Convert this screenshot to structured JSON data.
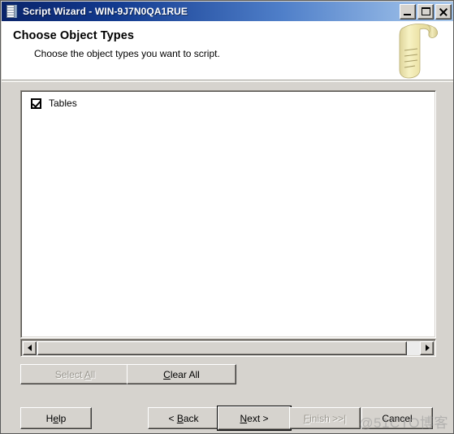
{
  "window": {
    "title": "Script Wizard - WIN-9J7N0QA1RUE",
    "icon": "script-document-icon",
    "controls": {
      "minimize": "Minimize",
      "maximize": "Maximize",
      "close": "Close"
    }
  },
  "header": {
    "title": "Choose Object Types",
    "subtitle": "Choose the object types you want to script.",
    "art": "scroll-parchment-icon"
  },
  "list": {
    "items": [
      {
        "label": "Tables",
        "checked": true
      }
    ]
  },
  "scrollbar": {
    "left_arrow": "scroll-left-arrow-icon",
    "right_arrow": "scroll-right-arrow-icon"
  },
  "selection_buttons": {
    "select_all": {
      "label_before": "Select ",
      "accel": "A",
      "label_after": "ll",
      "disabled": true
    },
    "clear_all": {
      "label_before": "",
      "accel": "C",
      "label_after": "lear All",
      "disabled": false
    }
  },
  "footer_buttons": {
    "help": {
      "label_before": "H",
      "accel": "e",
      "label_after": "lp",
      "disabled": false,
      "default": false
    },
    "back": {
      "label_before": "< ",
      "accel": "B",
      "label_after": "ack",
      "disabled": false,
      "default": false
    },
    "next": {
      "label_before": "",
      "accel": "N",
      "label_after": "ext >",
      "disabled": false,
      "default": true
    },
    "finish": {
      "label_before": "",
      "accel": "F",
      "label_after": "inish >>|",
      "disabled": true,
      "default": false
    },
    "cancel": {
      "label_before": "Cancel",
      "accel": "",
      "label_after": "",
      "disabled": false,
      "default": false
    }
  },
  "watermark": {
    "text": "@51CTO博客"
  },
  "colors": {
    "title_bar_start": "#0a246a",
    "title_bar_end": "#a8c7ea",
    "dialog_face": "#d6d3ce",
    "header_bg": "#ffffff",
    "list_bg": "#ffffff",
    "disabled_text": "#9a978f",
    "scroll_art": "#ece3a8"
  }
}
